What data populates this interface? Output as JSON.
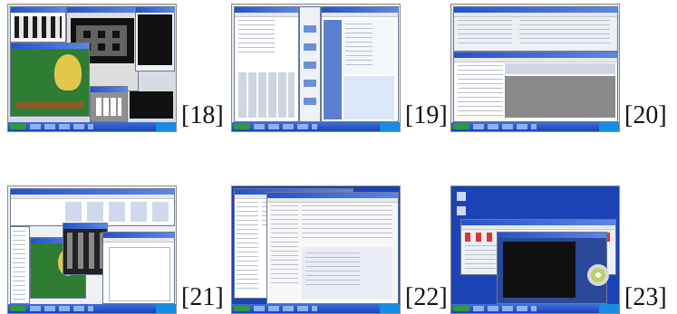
{
  "figure": {
    "items": [
      {
        "number_label": "[18]",
        "thumbnail": "screenshot-18"
      },
      {
        "number_label": "[19]",
        "thumbnail": "screenshot-19"
      },
      {
        "number_label": "[20]",
        "thumbnail": "screenshot-20"
      },
      {
        "number_label": "[21]",
        "thumbnail": "screenshot-21"
      },
      {
        "number_label": "[22]",
        "thumbnail": "screenshot-22"
      },
      {
        "number_label": "[23]",
        "thumbnail": "screenshot-23"
      }
    ]
  },
  "colors": {
    "desktop_blue": "#1b43b5",
    "taskbar_green": "#2f9a3a",
    "window_gray": "#f4f4f4"
  }
}
